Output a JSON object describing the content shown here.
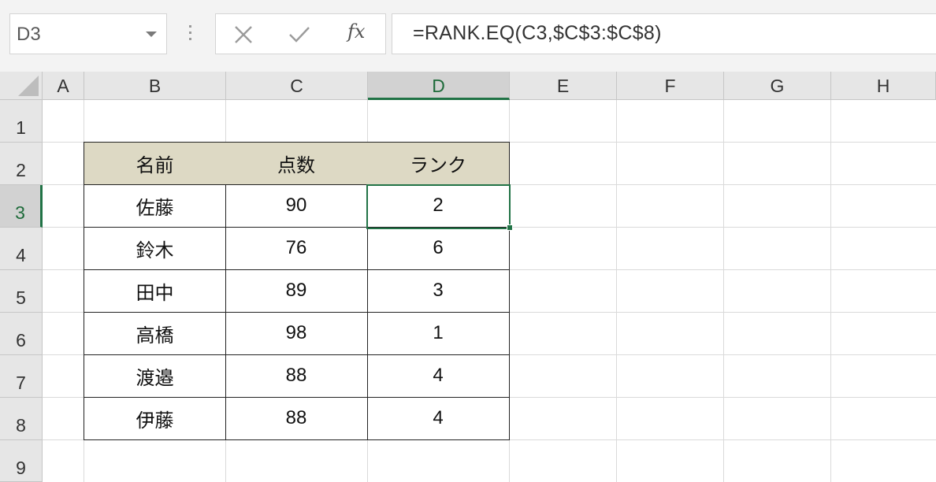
{
  "name_box": {
    "value": "D3"
  },
  "formula_bar": {
    "cancel_icon": "cancel-x-icon",
    "enter_icon": "checkmark-icon",
    "fx_label": "fx",
    "formula": "=RANK.EQ(C3,$C$3:$C$8)"
  },
  "columns": [
    "A",
    "B",
    "C",
    "D",
    "E",
    "F",
    "G",
    "H"
  ],
  "rows": [
    "1",
    "2",
    "3",
    "4",
    "5",
    "6",
    "7",
    "8",
    "9"
  ],
  "selected": {
    "column": "D",
    "row": "3"
  },
  "table": {
    "headers": [
      "名前",
      "点数",
      "ランク"
    ],
    "rows": [
      {
        "name": "佐藤",
        "score": "90",
        "rank": "2"
      },
      {
        "name": "鈴木",
        "score": "76",
        "rank": "6"
      },
      {
        "name": "田中",
        "score": "89",
        "rank": "3"
      },
      {
        "name": "高橋",
        "score": "98",
        "rank": "1"
      },
      {
        "name": "渡邉",
        "score": "88",
        "rank": "4"
      },
      {
        "name": "伊藤",
        "score": "88",
        "rank": "4"
      }
    ]
  },
  "colors": {
    "header_fill": "#ddd9c4",
    "selection": "#217346"
  }
}
